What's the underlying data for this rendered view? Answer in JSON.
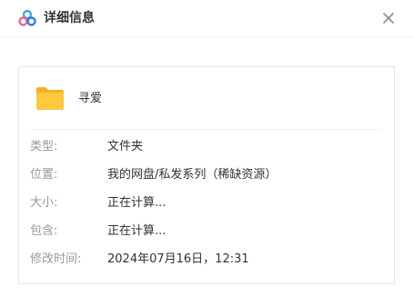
{
  "dialog": {
    "title": "详细信息",
    "app_icon": "baidu-netdisk-cloud-icon",
    "close_icon": "close-icon"
  },
  "item": {
    "icon": "folder-icon",
    "name": "寻爱"
  },
  "details": [
    {
      "label": "类型:",
      "value": "文件夹"
    },
    {
      "label": "位置:",
      "value": "我的网盘/私发系列（稀缺资源）"
    },
    {
      "label": "大小:",
      "value": "正在计算..."
    },
    {
      "label": "包含:",
      "value": "正在计算..."
    },
    {
      "label": "修改时间:",
      "value": "2024年07月16日，12:31"
    }
  ],
  "colors": {
    "folder_yellow": "#FFC83D",
    "label_gray": "#999999",
    "text_dark": "#333333",
    "icon_blue": "#3AA8F5",
    "icon_pink": "#F06292"
  }
}
